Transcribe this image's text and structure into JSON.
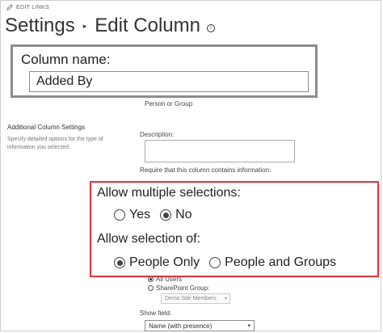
{
  "header": {
    "edit_links": "EDIT LINKS",
    "breadcrumb_root": "Settings",
    "breadcrumb_separator": "▸",
    "page_title": "Edit Column",
    "info_icon": "i"
  },
  "column_name": {
    "label": "Column name:",
    "value": "Added By"
  },
  "column_type": "Person or Group",
  "additional_settings": {
    "title": "Additional Column Settings",
    "description": "Specify detailed options for the type of information you selected."
  },
  "description_field": {
    "label": "Description:",
    "value": ""
  },
  "require_label": "Require that this column contains information:",
  "allow_multiple": {
    "label": "Allow multiple selections:",
    "options": [
      "Yes",
      "No"
    ],
    "selected": "No"
  },
  "allow_selection": {
    "label": "Allow selection of:",
    "options": [
      "People Only",
      "People and Groups"
    ],
    "selected": "People Only"
  },
  "choose_from": {
    "options": [
      "All Users",
      "SharePoint Group:"
    ],
    "selected": "All Users",
    "group_select_value": "Demo Site Members"
  },
  "show_field": {
    "label": "Show field:",
    "value": "Name (with presence)"
  },
  "colors": {
    "highlight_border": "#e0313d",
    "name_box_border": "#8c8c8c"
  }
}
